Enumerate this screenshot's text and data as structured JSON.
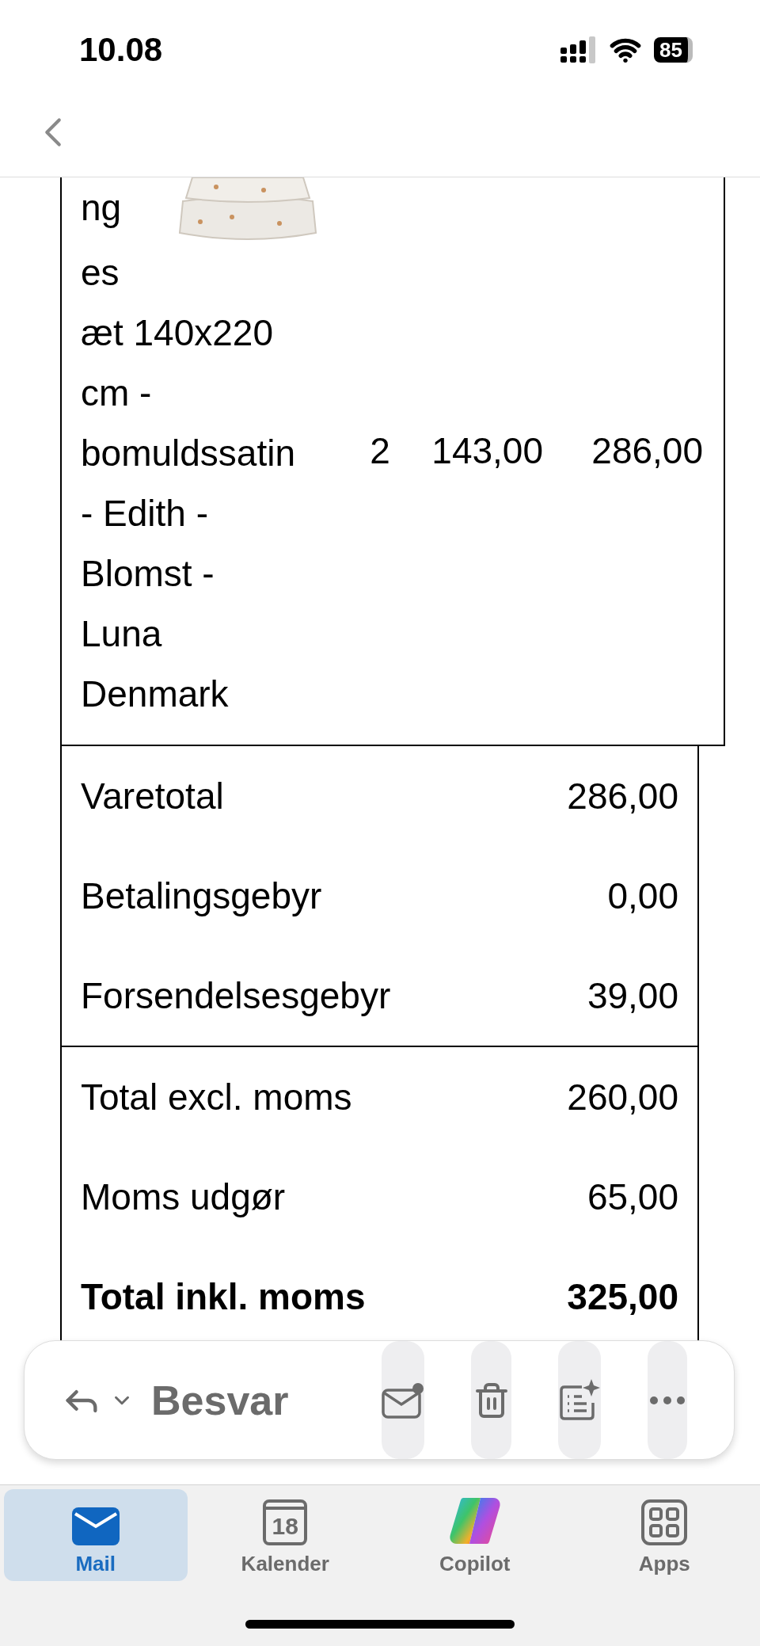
{
  "status_bar": {
    "time": "10.08",
    "battery": "85"
  },
  "product_row": {
    "description_lines": [
      "ng",
      "es",
      "æt 140x220",
      "cm -",
      "bomuldssatin",
      "- Edith -",
      "Blomst -",
      "Luna",
      "Denmark"
    ],
    "quantity": "2",
    "unit_price": "143,00",
    "total": "286,00"
  },
  "summary_groups": [
    {
      "rows": [
        {
          "label": "Varetotal",
          "value": "286,00",
          "emphasized": false
        },
        {
          "label": "Betalingsgebyr",
          "value": "0,00",
          "emphasized": false
        },
        {
          "label": "Forsendelsesgebyr",
          "value": "39,00",
          "emphasized": false
        }
      ]
    },
    {
      "rows": [
        {
          "label": "Total excl. moms",
          "value": "260,00",
          "emphasized": false
        },
        {
          "label": "Moms udgør",
          "value": "65,00",
          "emphasized": false
        },
        {
          "label": "Total inkl. moms",
          "value": "325,00",
          "emphasized": true
        }
      ]
    }
  ],
  "action_bar": {
    "reply_label": "Besvar"
  },
  "tabs": [
    {
      "kind": "mail",
      "label": "Mail",
      "selected": true
    },
    {
      "kind": "calendar",
      "label": "Kalender",
      "selected": false,
      "icon_text": "18"
    },
    {
      "kind": "copilot",
      "label": "Copilot",
      "selected": false
    },
    {
      "kind": "apps",
      "label": "Apps",
      "selected": false
    }
  ]
}
